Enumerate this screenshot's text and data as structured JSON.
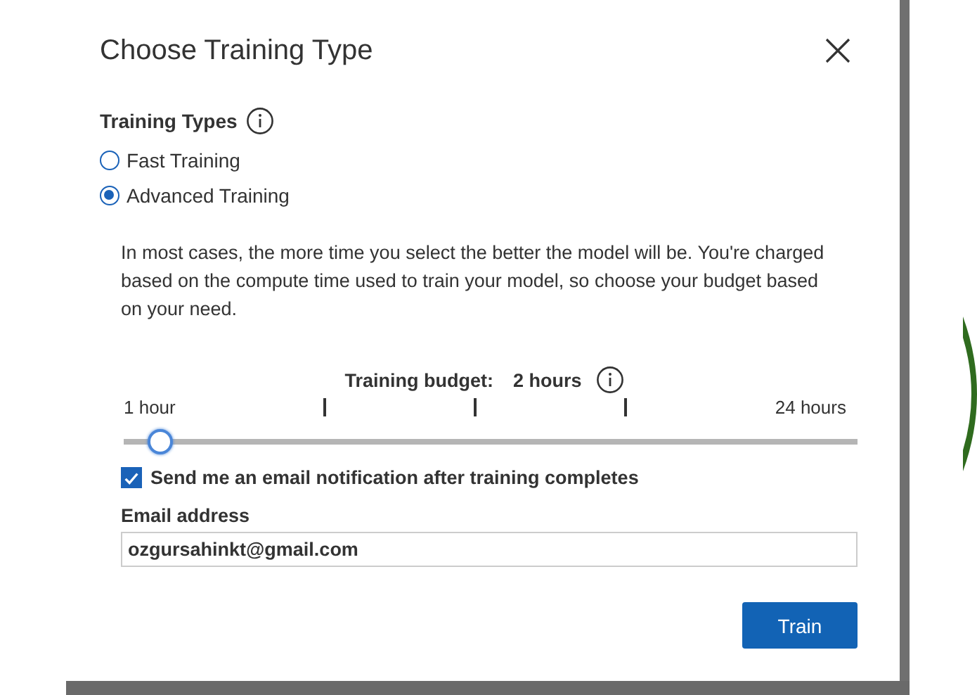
{
  "dialog": {
    "title": "Choose Training Type"
  },
  "training_types": {
    "label": "Training Types",
    "options": [
      {
        "label": "Fast Training",
        "selected": false
      },
      {
        "label": "Advanced Training",
        "selected": true
      }
    ]
  },
  "description": "In most cases, the more time you select the better the model will be. You're charged based on the compute time used to train your model, so choose your budget based on your need.",
  "budget": {
    "label": "Training budget:",
    "value": "2 hours",
    "min_label": "1 hour",
    "max_label": "24 hours",
    "level": 0.05
  },
  "notification": {
    "label": "Send me an email notification after training completes",
    "checked": true
  },
  "email": {
    "label": "Email address",
    "value": "ozgursahinkt@gmail.com"
  },
  "buttons": [
    "Train"
  ]
}
